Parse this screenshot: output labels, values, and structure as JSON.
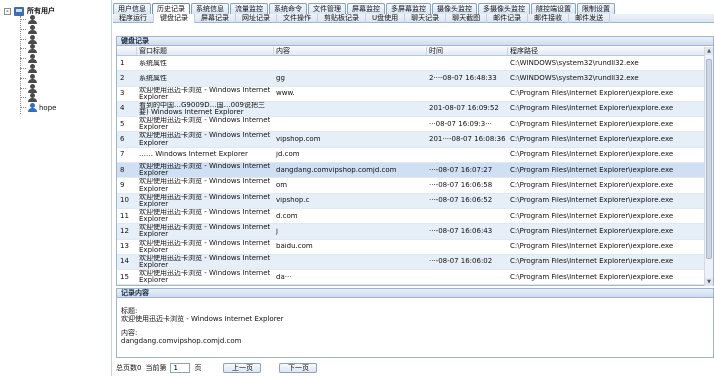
{
  "tree": {
    "root_label": "所有用户",
    "expander": "-",
    "children": [
      "",
      "",
      "",
      "",
      "",
      "",
      "",
      "",
      "",
      "hope"
    ],
    "selected_index": 9
  },
  "tabs_row1": [
    "用户信息",
    "历史记录",
    "系统信息",
    "流量监控",
    "系统命令",
    "文件管理",
    "屏幕监控",
    "多屏幕监控",
    "摄像头监控",
    "多摄像头监控",
    "隧控端设置",
    "限制设置"
  ],
  "tabs_row1_active": 1,
  "tabs_row2": [
    "程序运行",
    "键盘记录",
    "屏幕记录",
    "网址记录",
    "文件操作",
    "剪贴板记录",
    "U盘使用",
    "聊天记录",
    "聊天截图",
    "邮件记录",
    "邮件接收",
    "邮件发送"
  ],
  "tabs_row2_active": 1,
  "panel": {
    "title": "键盘记录",
    "columns": {
      "idx": "",
      "title": "窗口标题",
      "content": "内容",
      "time": "时间",
      "path": "程序路径"
    },
    "rows": [
      {
        "idx": "1",
        "title": "系统属性",
        "content": "",
        "time": "",
        "path": "C:\\WINDOWS\\system32\\rundll32.exe"
      },
      {
        "idx": "2",
        "title": "系统属性",
        "content": "gg",
        "time": "2···-08-07 16:48:33",
        "path": "C:\\WINDOWS\\system32\\rundll32.exe"
      },
      {
        "idx": "3",
        "title": "欢迎使用迅迈卡浏览 - Windows Internet Explorer",
        "content": "www.",
        "time": "",
        "path": "C:\\Program Files\\Internet Explorer\\iexplore.exe"
      },
      {
        "idx": "4",
        "title": "看到的中国…G9009D…国…009说把三要) Windows Internet Explorer",
        "content": "",
        "time": "201-08-07 16:09:52",
        "path": "C:\\Program Files\\Internet Explorer\\iexplore.exe"
      },
      {
        "idx": "5",
        "title": "欢迎使用迅迈卡浏览 - Windows Internet Explorer",
        "content": "",
        "time": "···08-07 16:09:3···",
        "path": "C:\\Program Files\\Internet Explorer\\iexplore.exe"
      },
      {
        "idx": "6",
        "title": "欢迎使用迅迈卡浏览 - Windows Internet Explorer",
        "content": "vipshop.com",
        "time": "201···-08-07 16:08:36",
        "path": "C:\\Program Files\\Internet Explorer\\iexplore.exe"
      },
      {
        "idx": "7",
        "title": "…… Windows Internet Explorer",
        "content": "jd.com",
        "time": "",
        "path": "C:\\Program Files\\Internet Explorer\\iexplore.exe"
      },
      {
        "idx": "8",
        "title": "欢迎使用迅迈卡浏览 - Windows Internet Explorer",
        "content": "dangdang.comvipshop.comjd.com",
        "time": "···-08-07 16:07:27",
        "path": "C:\\Program Files\\Internet Explorer\\iexplore.exe"
      },
      {
        "idx": "9",
        "title": "欢迎使用迅迈卡浏览 - Windows Internet Explorer",
        "content": "om",
        "time": "···-08-07 16:06:58",
        "path": "C:\\Program Files\\Internet Explorer\\iexplore.exe"
      },
      {
        "idx": "10",
        "title": "欢迎使用迅迈卡浏览 - Windows Internet Explorer",
        "content": "vipshop.c",
        "time": "···-08-07 16:06:52",
        "path": "C:\\Program Files\\Internet Explorer\\iexplore.exe"
      },
      {
        "idx": "11",
        "title": "欢迎使用迅迈卡浏览 - Windows Internet Explorer",
        "content": "d.com",
        "time": "",
        "path": "C:\\Program Files\\Internet Explorer\\iexplore.exe"
      },
      {
        "idx": "12",
        "title": "欢迎使用迅迈卡浏览 - Windows Internet Explorer",
        "content": "j",
        "time": "···-08-07 16:06:43",
        "path": "C:\\Program Files\\Internet Explorer\\iexplore.exe"
      },
      {
        "idx": "13",
        "title": "欢迎使用迅迈卡浏览 - Windows Internet Explorer",
        "content": "baidu.com",
        "time": "",
        "path": "C:\\Program Files\\Internet Explorer\\iexplore.exe"
      },
      {
        "idx": "14",
        "title": "欢迎使用迅迈卡浏览 - Windows Internet Explorer",
        "content": "",
        "time": "···-08-07 16:06:02",
        "path": "C:\\Program Files\\Internet Explorer\\iexplore.exe"
      },
      {
        "idx": "15",
        "title": "欢迎使用迅迈卡浏览 - Windows Internet Explorer",
        "content": "da···",
        "time": "",
        "path": "C:\\Program Files\\Internet Explorer\\iexplore.exe"
      }
    ],
    "selected_row": 7
  },
  "detail": {
    "title": "记录内容",
    "label_title": "标题:",
    "value_title": "欢迎使用迅迈卡浏览 - Windows Internet Explorer",
    "label_content": "内容:",
    "value_content": "dangdang.comvipshop.comjd.com"
  },
  "pager": {
    "total_label": "总页数0",
    "current_label": "当前第",
    "current_value": "1",
    "page_unit": "页",
    "prev_label": "上一页",
    "next_label": "下一页"
  }
}
